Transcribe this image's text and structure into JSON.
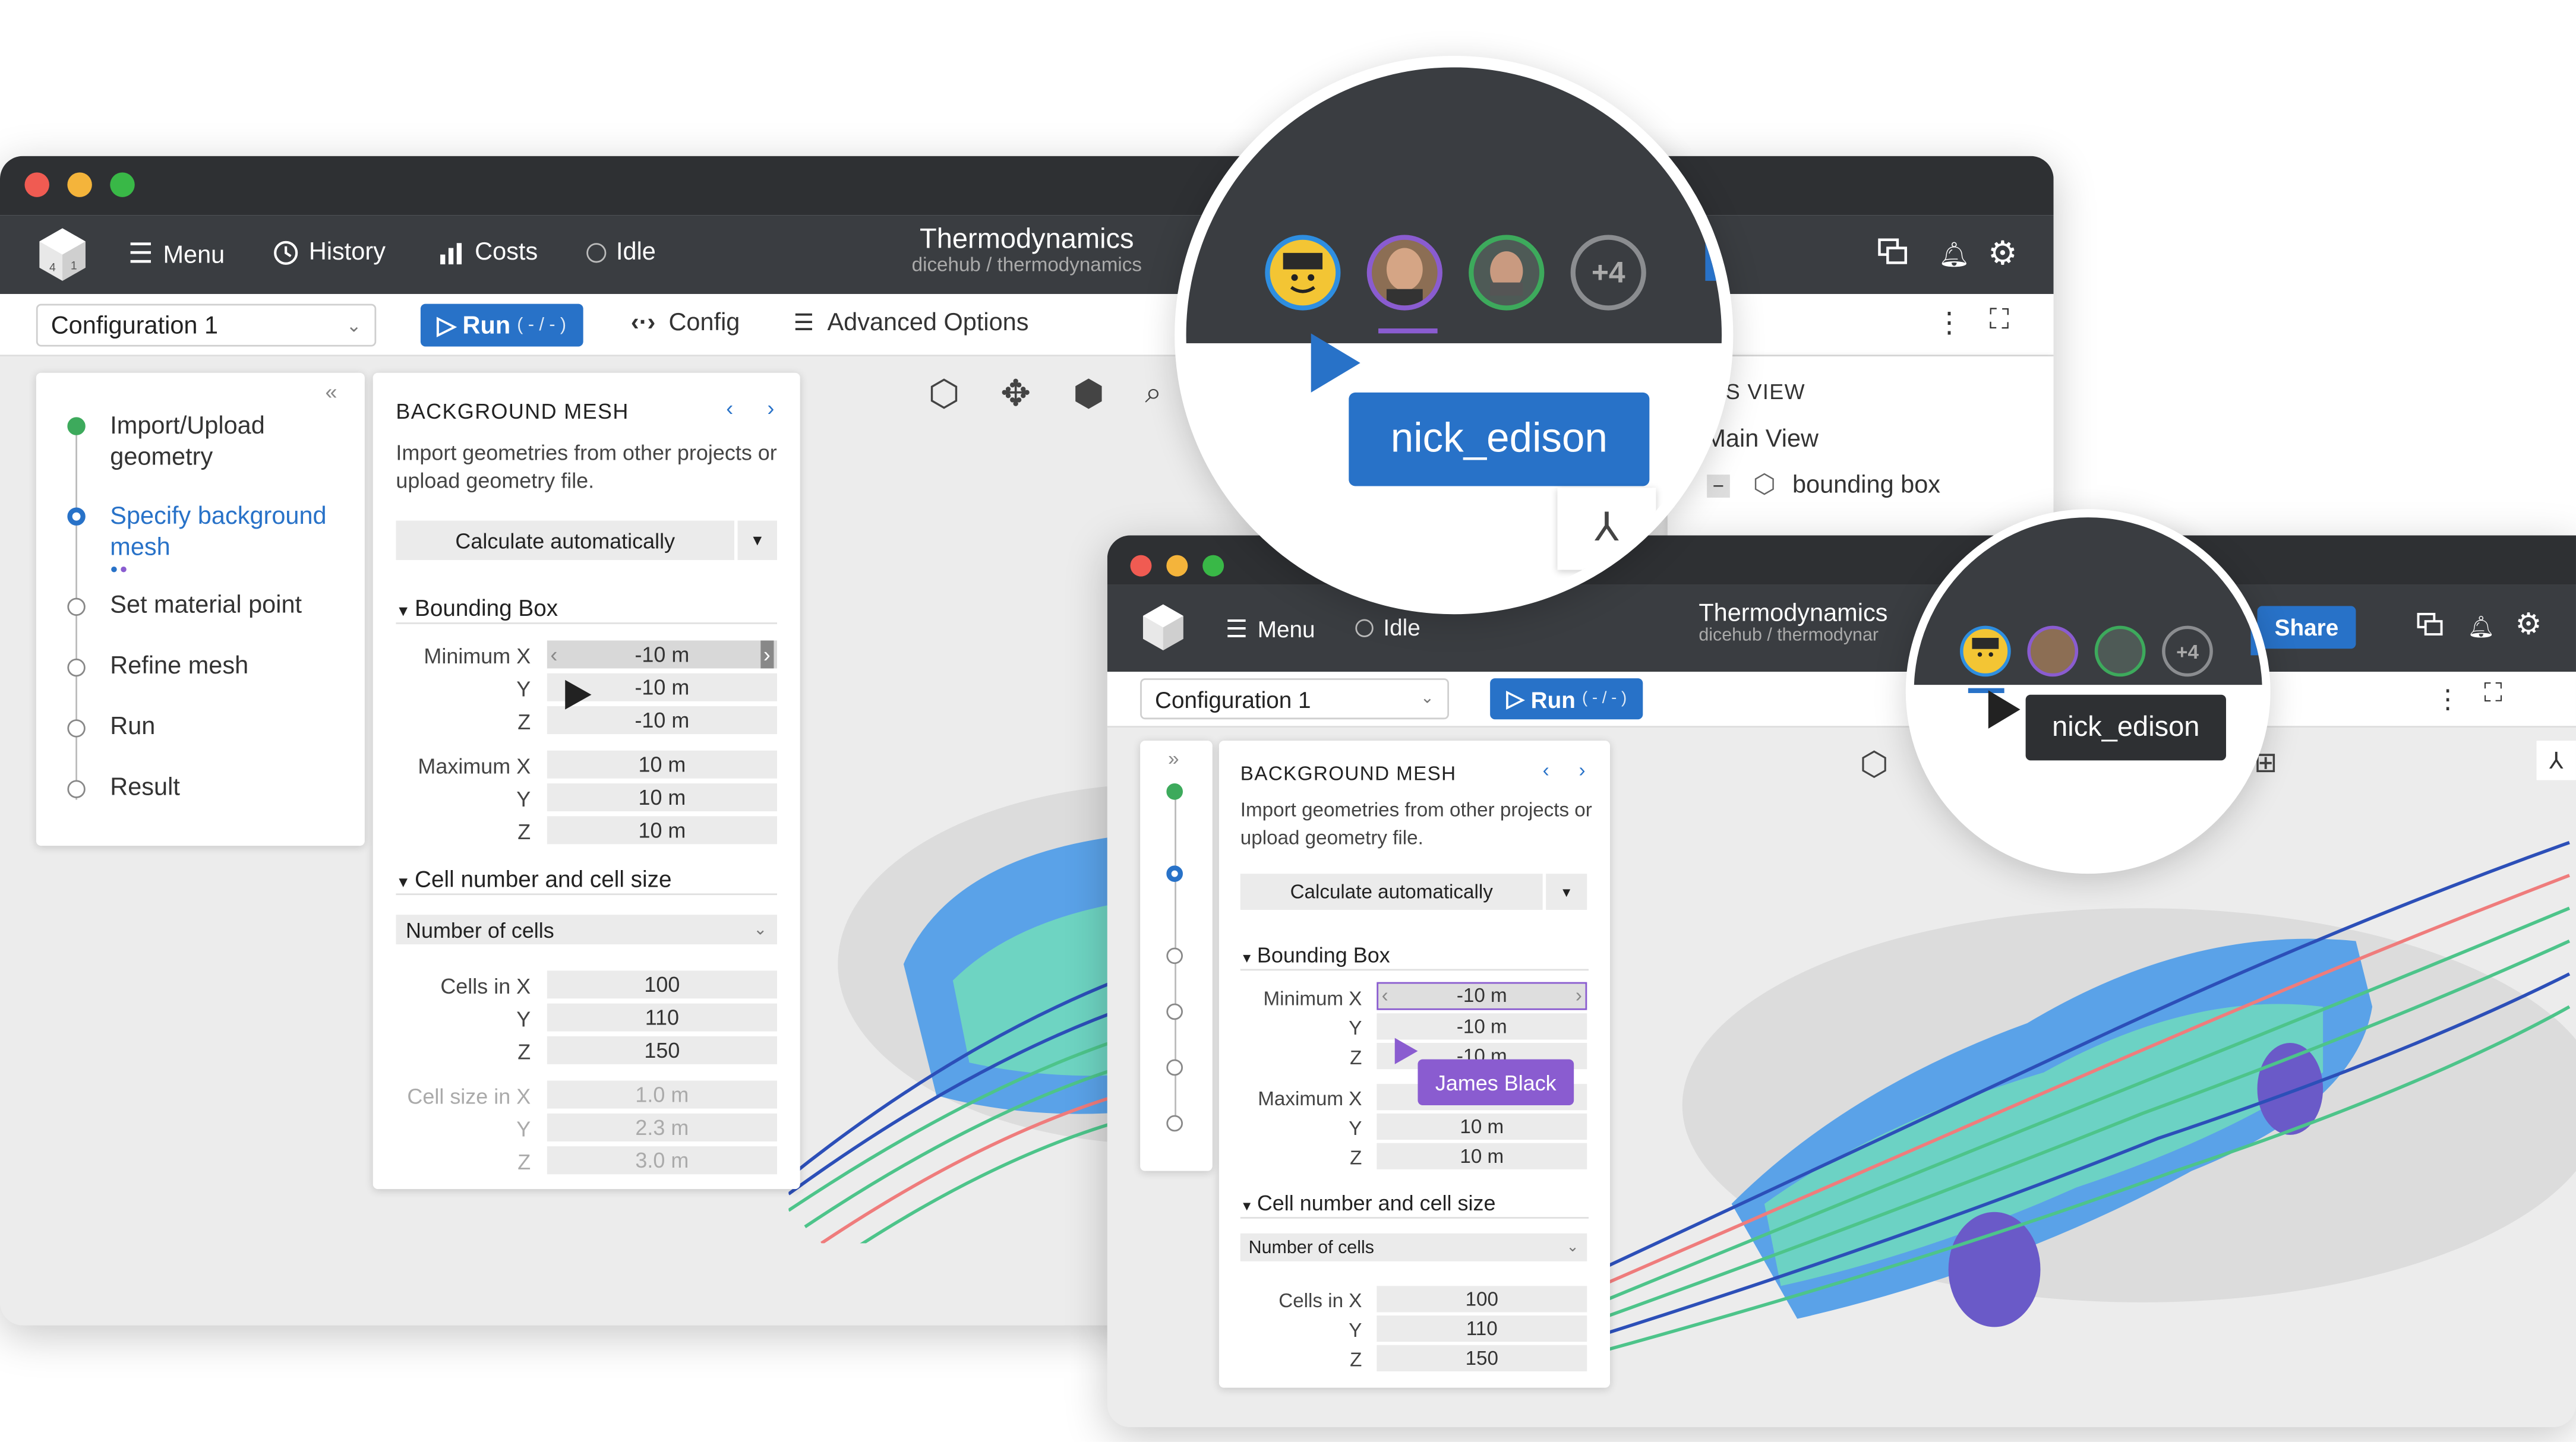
{
  "app": {
    "title": "Thermodynamics",
    "path": "dicehub / thermodynamics",
    "path_short": "dicehub / thermodynar"
  },
  "topbar": {
    "menu": "Menu",
    "history": "History",
    "costs": "Costs",
    "status": "Idle",
    "share": "Share"
  },
  "toolbar": {
    "configuration": "Configuration 1",
    "run_label": "Run",
    "run_suffix": "( - / - )",
    "config": "Config",
    "advanced": "Advanced Options"
  },
  "steps": [
    {
      "label": "Import/Upload geometry",
      "state": "done"
    },
    {
      "label": "Specify background mesh",
      "state": "active"
    },
    {
      "label": "Set material point",
      "state": "todo"
    },
    {
      "label": "Refine mesh",
      "state": "todo"
    },
    {
      "label": "Run",
      "state": "todo"
    },
    {
      "label": "Result",
      "state": "todo"
    }
  ],
  "panel": {
    "title": "BACKGROUND MESH",
    "description": "Import geometries from other projects or upload geometry file.",
    "calc": "Calculate automatically",
    "bbox_title": "Bounding Box",
    "min_x_label": "Minimum X",
    "max_x_label": "Maximum X",
    "y_label": "Y",
    "z_label": "Z",
    "min": [
      "-10 m",
      "-10 m",
      "-10 m"
    ],
    "max": [
      "10 m",
      "10 m",
      "10 m"
    ],
    "cell_title": "Cell number and cell size",
    "cell_mode": "Number of cells",
    "cells_x_label": "Cells in X",
    "cells": [
      "100",
      "110",
      "150"
    ],
    "cellsize_x_label": "Cell size in X",
    "cellsize": [
      "1.0 m",
      "2.3 m",
      "3.0 m"
    ]
  },
  "objects_view": {
    "title": "TS VIEW",
    "main": "Main View",
    "item": "bounding box"
  },
  "users": {
    "more": "+4",
    "cursor1": "nick_edison",
    "cursor2": "James Black"
  },
  "colors": {
    "accent": "#2872c8",
    "purple_user": "#8a5cd0",
    "done": "#3daa5c",
    "topbar": "#3a3d41"
  }
}
